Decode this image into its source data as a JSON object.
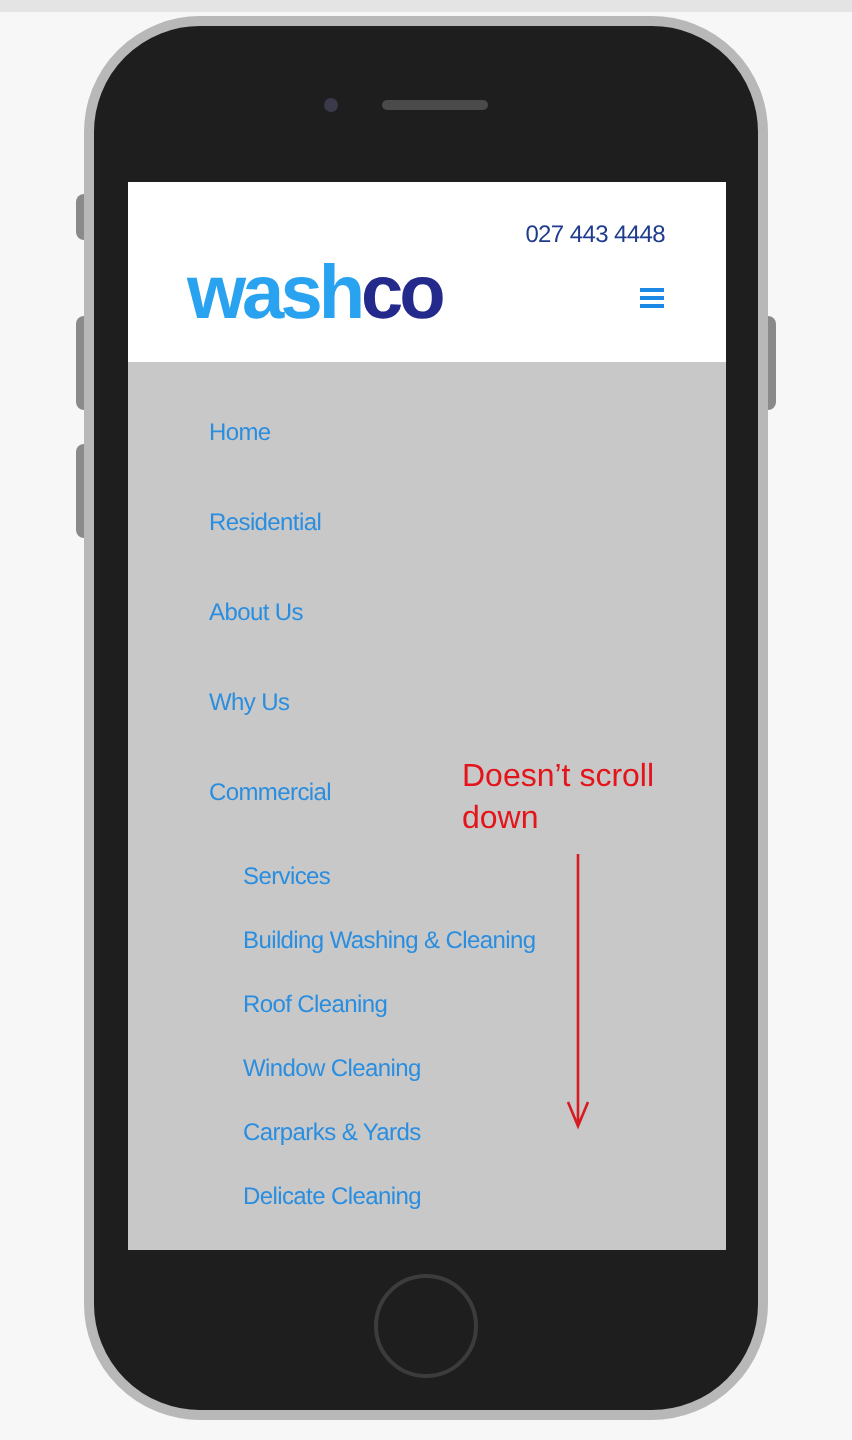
{
  "header": {
    "phone": "027 443 4448",
    "logo_main": "wash",
    "logo_accent": "co"
  },
  "menu": [
    {
      "label": "Home"
    },
    {
      "label": "Residential"
    },
    {
      "label": "About Us"
    },
    {
      "label": "Why Us"
    },
    {
      "label": "Commercial",
      "children": [
        {
          "label": "Services"
        },
        {
          "label": "Building Washing & Cleaning"
        },
        {
          "label": "Roof Cleaning"
        },
        {
          "label": "Window Cleaning"
        },
        {
          "label": "Carparks & Yards"
        },
        {
          "label": "Delicate Cleaning"
        }
      ]
    }
  ],
  "annotation": {
    "text": "Doesn’t scroll down"
  }
}
